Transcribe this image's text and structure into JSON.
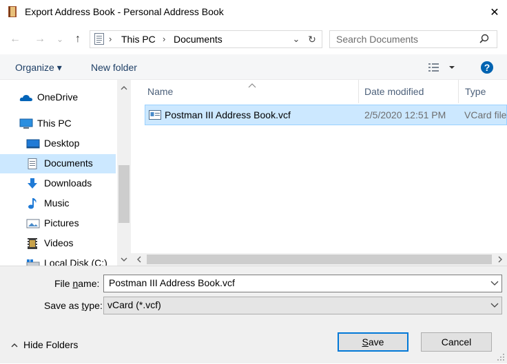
{
  "window": {
    "title": "Export Address Book - Personal Address Book",
    "close_glyph": "✕"
  },
  "nav": {
    "back_glyph": "←",
    "forward_glyph": "→",
    "recent_glyph": "⌄",
    "up_glyph": "↑",
    "breadcrumbs": [
      "This PC",
      "Documents"
    ],
    "crumb_separator": "›",
    "dropdown_glyph": "⌄",
    "refresh_glyph": "↻",
    "search_placeholder": "Search Documents"
  },
  "toolbar": {
    "organize_label": "Organize ▾",
    "new_folder_label": "New folder"
  },
  "sidebar": {
    "items": [
      {
        "label": "OneDrive",
        "icon": "onedrive-icon"
      },
      {
        "label": "This PC",
        "icon": "this-pc-icon"
      },
      {
        "label": "Desktop",
        "icon": "desktop-icon"
      },
      {
        "label": "Documents",
        "icon": "documents-icon",
        "selected": true
      },
      {
        "label": "Downloads",
        "icon": "downloads-icon"
      },
      {
        "label": "Music",
        "icon": "music-icon"
      },
      {
        "label": "Pictures",
        "icon": "pictures-icon"
      },
      {
        "label": "Videos",
        "icon": "videos-icon"
      },
      {
        "label": "Local Disk (C:)",
        "icon": "local-disk-icon"
      }
    ]
  },
  "filelist": {
    "columns": [
      "Name",
      "Date modified",
      "Type"
    ],
    "rows": [
      {
        "name": "Postman III Address Book.vcf",
        "date": "2/5/2020 12:51 PM",
        "type": "VCard file",
        "selected": true
      }
    ]
  },
  "form": {
    "file_name_label_pre": "File ",
    "file_name_label_u": "n",
    "file_name_label_post": "ame:",
    "file_name_value": "Postman III Address Book.vcf",
    "save_type_label_pre": "Save as ",
    "save_type_label_u": "t",
    "save_type_label_post": "ype:",
    "save_type_value": "vCard (*.vcf)"
  },
  "footer": {
    "hide_folders_label": "Hide Folders",
    "save_label_u": "S",
    "save_label_post": "ave",
    "cancel_label": "Cancel"
  },
  "colors": {
    "selection": "#cce8ff",
    "accent": "#0078d7",
    "link_text": "#1e3f66"
  }
}
